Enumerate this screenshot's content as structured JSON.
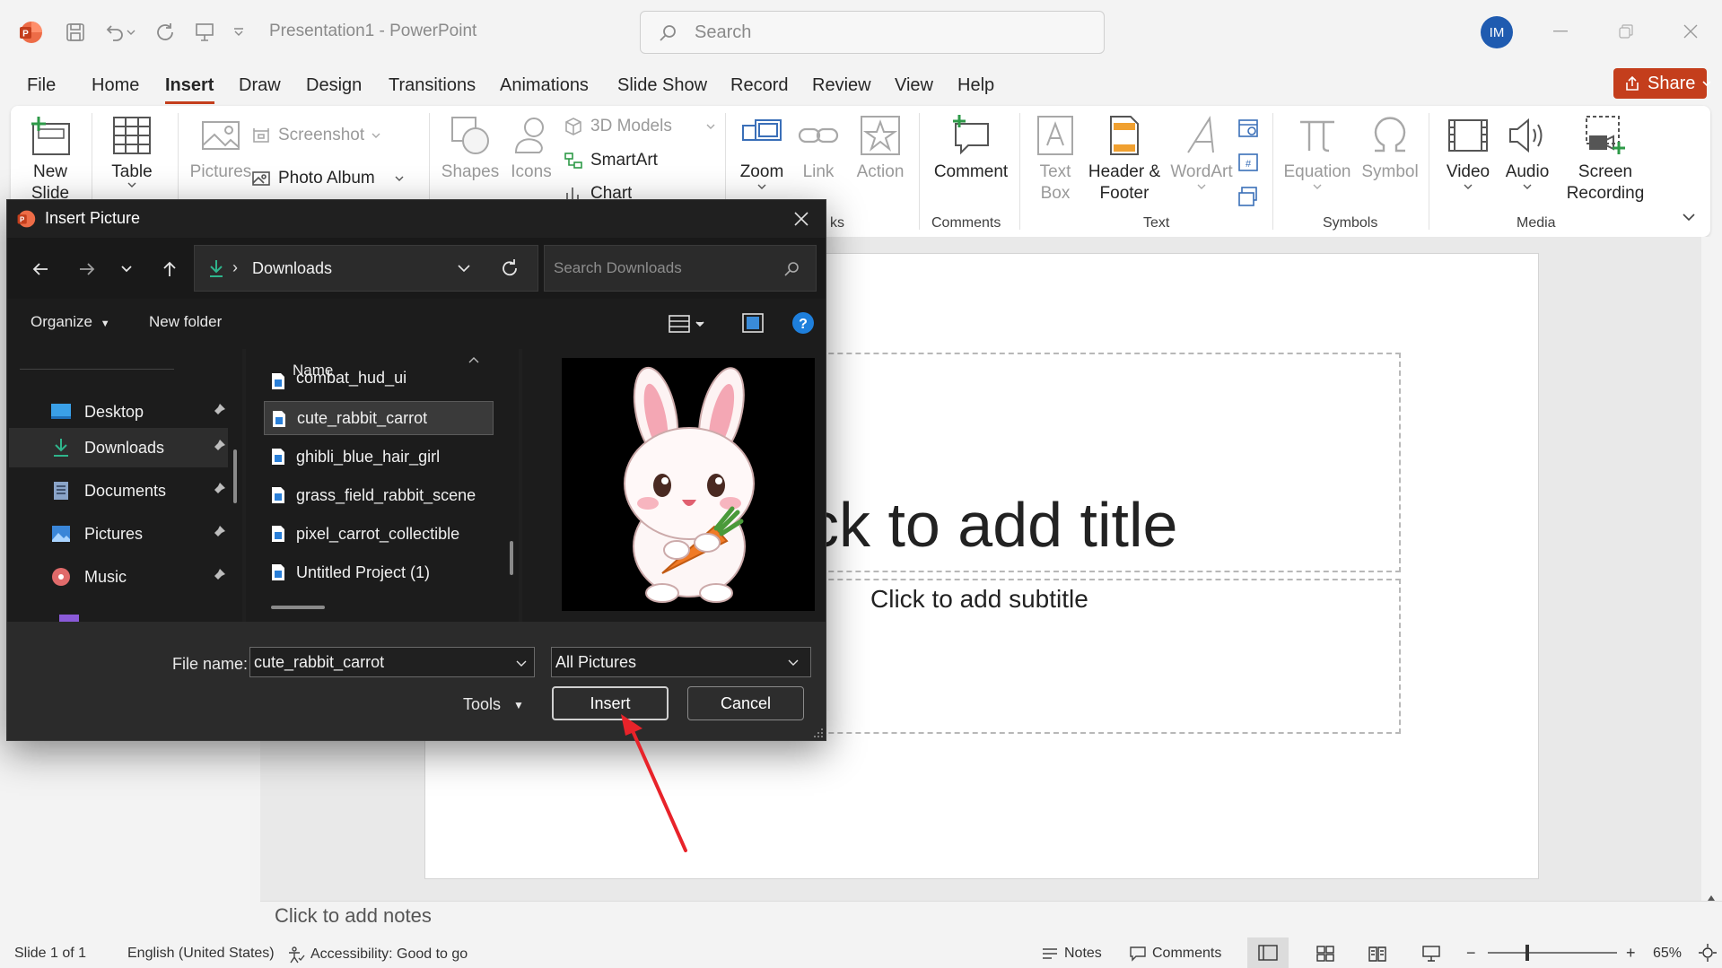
{
  "app": {
    "doc_title": "Presentation1  -  PowerPoint",
    "search_placeholder": "Search",
    "avatar_initials": "IM",
    "share_label": "Share"
  },
  "menu": {
    "tabs": [
      "File",
      "Home",
      "Insert",
      "Draw",
      "Design",
      "Transitions",
      "Animations",
      "Slide Show",
      "Record",
      "Review",
      "View",
      "Help"
    ],
    "active": "Insert"
  },
  "ribbon": {
    "new_slide": "New Slide",
    "table": "Table",
    "pictures": "Pictures",
    "screenshot": "Screenshot",
    "photo_album": "Photo Album",
    "shapes": "Shapes",
    "icons": "Icons",
    "models_3d": "3D Models",
    "smartart": "SmartArt",
    "chart": "Chart",
    "zoom": "Zoom",
    "link": "Link",
    "action": "Action",
    "comment": "Comment",
    "comments_group": "Comments",
    "text_box": "Text Box",
    "header_footer": "Header & Footer",
    "wordart": "WordArt",
    "text_group": "Text",
    "equation": "Equation",
    "symbol": "Symbol",
    "symbols_group": "Symbols",
    "video": "Video",
    "audio": "Audio",
    "screen_recording": "Screen Recording",
    "media_group": "Media",
    "links_group_fragment": "ks"
  },
  "slide": {
    "title_placeholder": "ck to add title",
    "subtitle_placeholder": "Click to add subtitle",
    "notes_placeholder": "Click to add notes"
  },
  "status": {
    "slide_info": "Slide 1 of 1",
    "language": "English (United States)",
    "accessibility": "Accessibility: Good to go",
    "notes": "Notes",
    "comments": "Comments",
    "zoom": "65%"
  },
  "dialog": {
    "title": "Insert Picture",
    "path": "Downloads",
    "search_placeholder": "Search Downloads",
    "organize": "Organize",
    "new_folder": "New folder",
    "column_name": "Name",
    "nav_items": [
      {
        "label": "Desktop",
        "icon": "desktop-icon",
        "color": "#3aa0e8"
      },
      {
        "label": "Downloads",
        "icon": "download-icon",
        "color": "#2fb58c"
      },
      {
        "label": "Documents",
        "icon": "document-icon",
        "color": "#8aa4c8"
      },
      {
        "label": "Pictures",
        "icon": "pictures-icon",
        "color": "#3a86d8"
      },
      {
        "label": "Music",
        "icon": "music-icon",
        "color": "#e06a6a"
      }
    ],
    "files": [
      "combat_hud_ui",
      "cute_rabbit_carrot",
      "ghibli_blue_hair_girl",
      "grass_field_rabbit_scene",
      "pixel_carrot_collectible",
      "Untitled Project (1)"
    ],
    "selected_file": "cute_rabbit_carrot",
    "file_name_label": "File name:",
    "file_name_value": "cute_rabbit_carrot",
    "file_type": "All Pictures",
    "tools": "Tools",
    "insert": "Insert",
    "cancel": "Cancel"
  },
  "colors": {
    "accent": "#c43e1c",
    "avatar": "#1f5bb0",
    "dialog_bg": "#202020",
    "annotation_arrow": "#e8232a"
  }
}
